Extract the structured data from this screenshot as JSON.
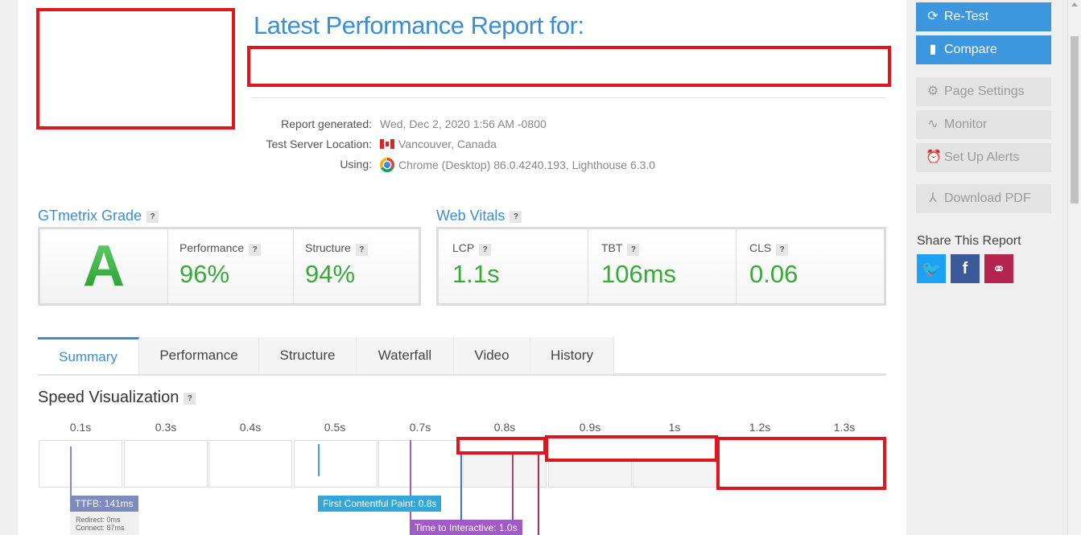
{
  "header": {
    "title": "Latest Performance Report for:"
  },
  "report_meta": {
    "generated_label": "Report generated:",
    "generated_value": "Wed, Dec 2, 2020 1:56 AM -0800",
    "location_label": "Test Server Location:",
    "location_value": "Vancouver, Canada",
    "using_label": "Using:",
    "using_value": "Chrome (Desktop) 86.0.4240.193, Lighthouse 6.3.0"
  },
  "gtmetrix": {
    "title": "GTmetrix Grade",
    "grade": "A",
    "performance_label": "Performance",
    "performance_value": "96%",
    "structure_label": "Structure",
    "structure_value": "94%",
    "grade_color": "#3cb043"
  },
  "web_vitals": {
    "title": "Web Vitals",
    "lcp_label": "LCP",
    "lcp_value": "1.1s",
    "tbt_label": "TBT",
    "tbt_value": "106ms",
    "cls_label": "CLS",
    "cls_value": "0.06"
  },
  "tabs": [
    "Summary",
    "Performance",
    "Structure",
    "Waterfall",
    "Video",
    "History"
  ],
  "active_tab": "Summary",
  "speed": {
    "title": "Speed Visualization",
    "ticks": [
      "0.1s",
      "0.3s",
      "0.4s",
      "0.5s",
      "0.7s",
      "0.8s",
      "0.9s",
      "1s",
      "1.2s",
      "1.3s"
    ],
    "ttfb_label": "TTFB: 141ms",
    "ttfb_redirect": "Redirect: 0ms",
    "ttfb_connect": "Connect: 87ms",
    "fcp_label": "First Contentful Paint: 0.8s",
    "tti_label": "Time to Interactive: 1.0s"
  },
  "actions": {
    "retest": "Re-Test",
    "compare": "Compare",
    "page_settings": "Page Settings",
    "monitor": "Monitor",
    "alerts": "Set Up Alerts",
    "download_pdf": "Download PDF",
    "share_title": "Share This Report"
  },
  "help_mark": "?",
  "colors": {
    "accent": "#3b8ed4",
    "good": "#39a93a",
    "redaction": "#e0161f",
    "ttfb": "#7d8bbd",
    "fcp": "#33a8d8",
    "tti": "#a05bc4"
  }
}
